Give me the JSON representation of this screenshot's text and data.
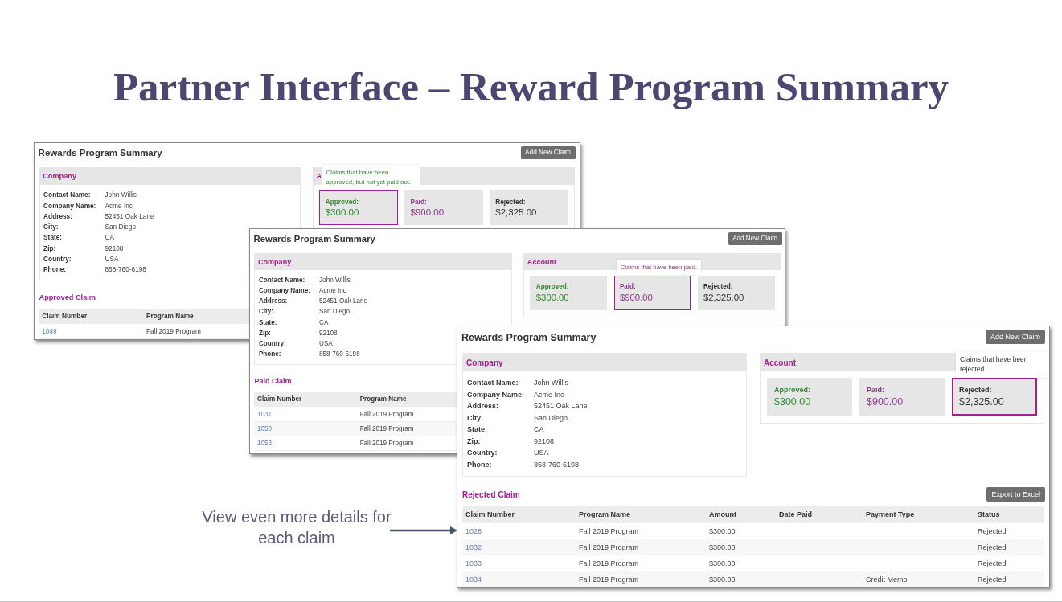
{
  "slide_title": "Partner Interface – Reward Program Summary",
  "windows": [
    {
      "title": "Rewards Program Summary",
      "add_button": "Add New Claim",
      "company": {
        "title": "Company",
        "fields": [
          {
            "label": "Contact Name:",
            "value": "John Willis"
          },
          {
            "label": "Company Name:",
            "value": "Acme Inc"
          },
          {
            "label": "Address:",
            "value": "52451 Oak Lane"
          },
          {
            "label": "City:",
            "value": "San Diego"
          },
          {
            "label": "State:",
            "value": "CA"
          },
          {
            "label": "Zip:",
            "value": "92108"
          },
          {
            "label": "Country:",
            "value": "USA"
          },
          {
            "label": "Phone:",
            "value": "858-760-6198"
          }
        ]
      },
      "account": {
        "title": "A",
        "tooltip": "Claims that have been approved, but not yet paid out.",
        "cards": [
          {
            "label": "Approved:",
            "amount": "$300.00",
            "color": "#2f8a2f",
            "selected": true
          },
          {
            "label": "Paid:",
            "amount": "$900.00",
            "color": "#8a3a8a",
            "selected": false
          },
          {
            "label": "Rejected:",
            "amount": "$2,325.00",
            "color": "#333333",
            "selected": false
          }
        ]
      },
      "claims": {
        "title": "Approved Claim",
        "columns": [
          "Claim Number",
          "Program Name"
        ],
        "rows": [
          [
            "1049",
            "Fall 2019 Program"
          ]
        ]
      }
    },
    {
      "title": "Rewards Program Summary",
      "add_button": "Add New Claim",
      "company": {
        "title": "Company",
        "fields": [
          {
            "label": "Contact Name:",
            "value": "John Willis"
          },
          {
            "label": "Company Name:",
            "value": "Acme Inc"
          },
          {
            "label": "Address:",
            "value": "52451 Oak Lane"
          },
          {
            "label": "City:",
            "value": "San Diego"
          },
          {
            "label": "State:",
            "value": "CA"
          },
          {
            "label": "Zip:",
            "value": "92108"
          },
          {
            "label": "Country:",
            "value": "USA"
          },
          {
            "label": "Phone:",
            "value": "858-760-6198"
          }
        ]
      },
      "account": {
        "title": "Account",
        "tooltip": "Claims that have been paid.",
        "cards": [
          {
            "label": "Approved:",
            "amount": "$300.00",
            "color": "#2f8a2f",
            "selected": false
          },
          {
            "label": "Paid:",
            "amount": "$900.00",
            "color": "#8a3a8a",
            "selected": true
          },
          {
            "label": "Rejected:",
            "amount": "$2,325.00",
            "color": "#333333",
            "selected": false
          }
        ]
      },
      "claims": {
        "title": "Paid Claim",
        "columns": [
          "Claim Number",
          "Program Name"
        ],
        "rows": [
          [
            "1031",
            "Fall 2019 Program"
          ],
          [
            "1050",
            "Fall 2019 Program"
          ],
          [
            "1053",
            "Fall 2019 Program"
          ]
        ]
      }
    },
    {
      "title": "Rewards Program Summary",
      "add_button": "Add New Claim",
      "company": {
        "title": "Company",
        "fields": [
          {
            "label": "Contact Name:",
            "value": "John Willis"
          },
          {
            "label": "Company Name:",
            "value": "Acme Inc"
          },
          {
            "label": "Address:",
            "value": "52451 Oak Lane"
          },
          {
            "label": "City:",
            "value": "San Diego"
          },
          {
            "label": "State:",
            "value": "CA"
          },
          {
            "label": "Zip:",
            "value": "92108"
          },
          {
            "label": "Country:",
            "value": "USA"
          },
          {
            "label": "Phone:",
            "value": "858-760-6198"
          }
        ]
      },
      "account": {
        "title": "Account",
        "tooltip": "Claims that have been rejected.",
        "cards": [
          {
            "label": "Approved:",
            "amount": "$300.00",
            "color": "#2f8a2f",
            "selected": false
          },
          {
            "label": "Paid:",
            "amount": "$900.00",
            "color": "#8a3a8a",
            "selected": false
          },
          {
            "label": "Rejected:",
            "amount": "$2,325.00",
            "color": "#333333",
            "selected": true
          }
        ]
      },
      "claims": {
        "title": "Rejected Claim",
        "export_button": "Export to Excel",
        "columns": [
          "Claim Number",
          "Program Name",
          "Amount",
          "Date Paid",
          "Payment Type",
          "Status"
        ],
        "rows": [
          [
            "1028",
            "Fall 2019 Program",
            "$300.00",
            null,
            null,
            "Rejected"
          ],
          [
            "1032",
            "Fall 2019 Program",
            "$300.00",
            null,
            null,
            "Rejected"
          ],
          [
            "1033",
            "Fall 2019 Program",
            "$300.00",
            null,
            null,
            "Rejected"
          ],
          [
            "1034",
            "Fall 2019 Program",
            "$300.00",
            null,
            "Credit Memo",
            "Rejected"
          ]
        ]
      }
    }
  ],
  "callout": {
    "text": "View even more details for each claim"
  }
}
